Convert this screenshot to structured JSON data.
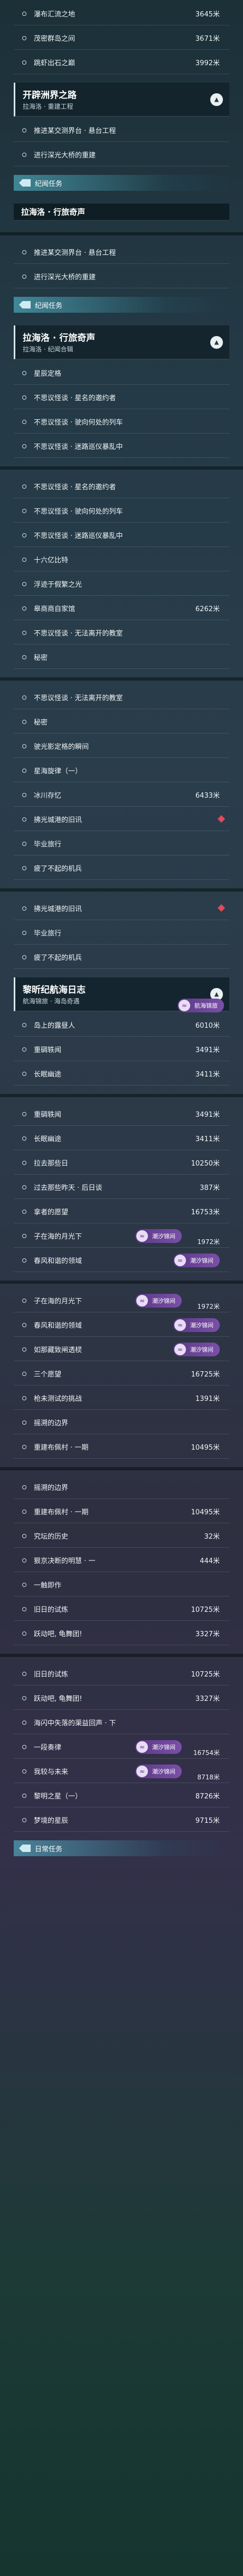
{
  "sections": [
    {
      "top": 0,
      "rows": [
        {
          "label": "瀑布汇流之地",
          "dist": "3645米"
        },
        {
          "label": "茂密群岛之间",
          "dist": "3671米"
        },
        {
          "label": "跳虾出石之巅",
          "dist": "3992米"
        }
      ]
    },
    {
      "header": {
        "title": "开辟洲界之路",
        "sub": "拉海洛 · 重建工程"
      },
      "rows": [
        {
          "label": "推进某交测界台 · 悬台工程"
        },
        {
          "label": "进行深光大桥的重建"
        }
      ]
    },
    {
      "category": "纪闻任务"
    },
    {
      "bar": "拉海洛 · 行旅奇声"
    },
    {
      "rows": [
        {
          "label": "推进某交测界台 · 悬台工程"
        },
        {
          "label": "进行深光大桥的重建"
        }
      ]
    },
    {
      "category": "纪闻任务"
    },
    {
      "header": {
        "title": "拉海洛 · 行旅奇声",
        "sub": "拉海洛 · 纪闻合辑"
      },
      "rows": [
        {
          "label": "星辰定格"
        },
        {
          "label": "不思议怪谈 · 星名的邀约者"
        },
        {
          "label": "不思议怪谈 · 驶向何处的列车"
        },
        {
          "label": "不思议怪谈 · 迷路巡仪暴乱中"
        }
      ]
    },
    {
      "rows": [
        {
          "label": "不思议怪谈 · 星名的邀约者"
        },
        {
          "label": "不思议怪谈 · 驶向何处的列车"
        },
        {
          "label": "不思议怪谈 · 迷路巡仪暴乱中"
        },
        {
          "label": "十六亿比特"
        },
        {
          "label": "浮迹于假繁之光"
        },
        {
          "label": "皋商商自家馆",
          "dist": "6262米"
        },
        {
          "label": "不思议怪谈 · 无法离开的教室"
        },
        {
          "label": "秘密"
        }
      ]
    },
    {
      "rows": [
        {
          "label": "不思议怪谈 · 无法离开的教室"
        },
        {
          "label": "秘密"
        },
        {
          "label": "驶光影定格的瞬间"
        },
        {
          "label": "星海旋律（一）"
        },
        {
          "label": "冰川存忆",
          "dist": "6433米"
        },
        {
          "label": "拂光城港的旧讯",
          "mark": true
        },
        {
          "label": "毕业旅行"
        },
        {
          "label": "疲了不起的机兵"
        }
      ]
    },
    {
      "rows": [
        {
          "label": "拂光城港的旧讯",
          "mark": true
        },
        {
          "label": "毕业旅行"
        },
        {
          "label": "疲了不起的机兵"
        }
      ]
    },
    {
      "header": {
        "title": "黎昕纪航海日志",
        "sub": "航海锦旅 · 海岛奇遇"
      },
      "tag": "航海锦旅",
      "rows": [
        {
          "label": "岛上的露昼人",
          "dist": "6010米"
        },
        {
          "label": "重碉轶闻",
          "dist": "3491米"
        },
        {
          "label": "长眠幽途",
          "dist": "3411米"
        }
      ]
    },
    {
      "rows": [
        {
          "label": "重碉轶闻",
          "dist": "3491米"
        },
        {
          "label": "长眠幽途",
          "dist": "3411米"
        },
        {
          "label": "拉去那些日",
          "dist": "10250米"
        },
        {
          "label": "过去那些昨天 · 后日谈",
          "dist": "387米"
        },
        {
          "label": "拿者的愿望",
          "dist": "16753米"
        },
        {
          "label": "子在海的月光下",
          "dist": "1972米",
          "tag": "潮汐锦间"
        },
        {
          "label": "春风和谐的领域",
          "tag": "潮汐锦间"
        }
      ]
    },
    {
      "rows": [
        {
          "label": "子在海的月光下",
          "dist": "1972米",
          "tag": "潮汐锦间"
        },
        {
          "label": "春风和谐的领域",
          "tag": "潮汐锦间"
        },
        {
          "label": "如那藏致闸透棂",
          "tag": "潮汐锦间"
        },
        {
          "label": "三个愿望",
          "dist": "16725米"
        },
        {
          "label": "枪未测试的挑战",
          "dist": "1391米"
        },
        {
          "label": "摇溯的边界"
        },
        {
          "label": "重建布佩村 · 一期",
          "dist": "10495米"
        }
      ]
    },
    {
      "rows": [
        {
          "label": "摇溯的边界"
        },
        {
          "label": "重建布佩村 · 一期",
          "dist": "10495米"
        },
        {
          "label": "究坛的历史",
          "dist": "32米"
        },
        {
          "label": "狠京决断的明慧 · 一",
          "dist": "444米"
        },
        {
          "label": "一触即作"
        },
        {
          "label": "旧日的试炼",
          "dist": "10725米"
        },
        {
          "label": "跃动吧, 龟舞团!",
          "dist": "3327米"
        }
      ]
    },
    {
      "rows": [
        {
          "label": "旧日的试炼",
          "dist": "10725米"
        },
        {
          "label": "跃动吧, 龟舞团!",
          "dist": "3327米"
        },
        {
          "label": "海闪中失落的渠益回声 · 下"
        },
        {
          "label": "一段奏律",
          "dist": "16754米",
          "tag": "潮汐锦间"
        },
        {
          "label": "我较与未来",
          "dist": "8718米",
          "tag": "潮汐锦间"
        },
        {
          "label": "黎明之星（一）",
          "dist": "8726米"
        },
        {
          "label": "梦境的星辰",
          "dist": "9715米"
        }
      ]
    },
    {
      "category": "日常任务"
    }
  ],
  "colors": {
    "accent": "#5ac8dc",
    "tag": "#6b44a0",
    "mark": "#e24a5a"
  },
  "icons": {
    "bullet": "circle-bullet-icon",
    "caret": "chevron-up-icon",
    "tag": "wave-badge-icon"
  }
}
